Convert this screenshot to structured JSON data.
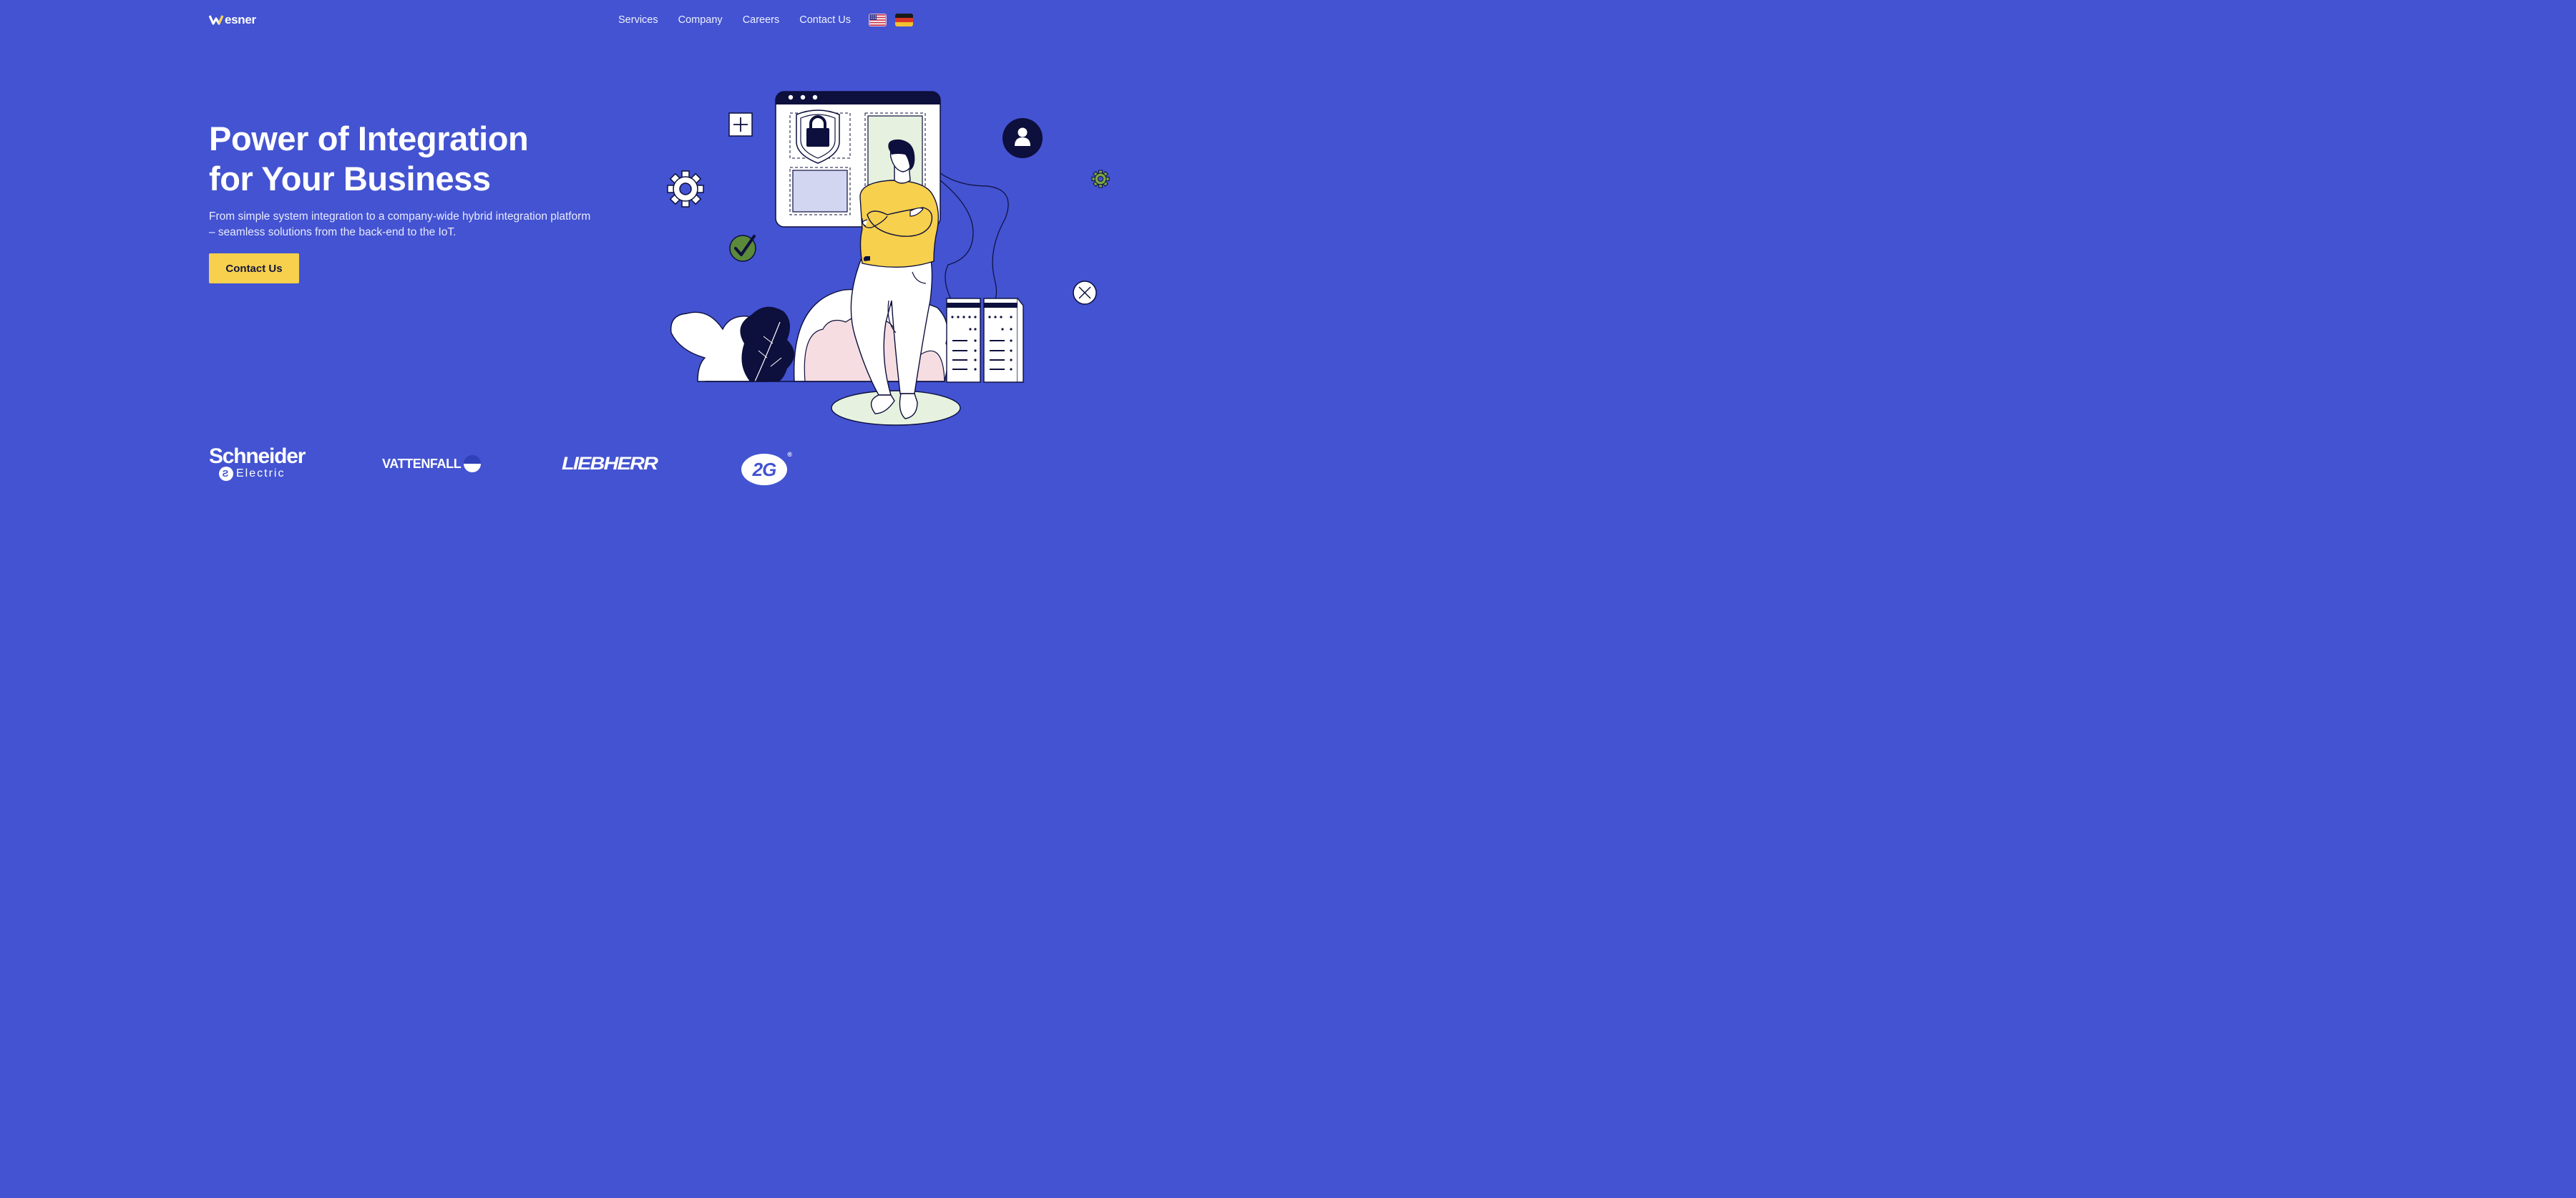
{
  "header": {
    "logo_text": "esner",
    "nav": [
      "Services",
      "Company",
      "Careers",
      "Contact Us"
    ],
    "flags": [
      "us-flag-icon",
      "de-flag-icon"
    ]
  },
  "hero": {
    "title_line1": "Power of Integration",
    "title_line2": "for Your Business",
    "subtitle_line1": "From simple system integration to a company-wide hybrid integration platform",
    "subtitle_line2": "– seamless solutions from the back-end to the IoT.",
    "cta_label": "Contact Us"
  },
  "clients": {
    "schneider_top": "Schneider",
    "schneider_bottom": "Electric",
    "vattenfall": "VATTENFALL",
    "liebherr": "LIEBHERR",
    "twog": "2G",
    "twog_reg": "®"
  },
  "colors": {
    "background": "#4353d1",
    "cta": "#f7d04d",
    "dark": "#0d0f3c",
    "pink": "#f5dde2",
    "green_pale": "#e6f2df",
    "panel": "#d2d6f0",
    "check_green": "#5b8a3a",
    "gear_green": "#7aa542"
  }
}
